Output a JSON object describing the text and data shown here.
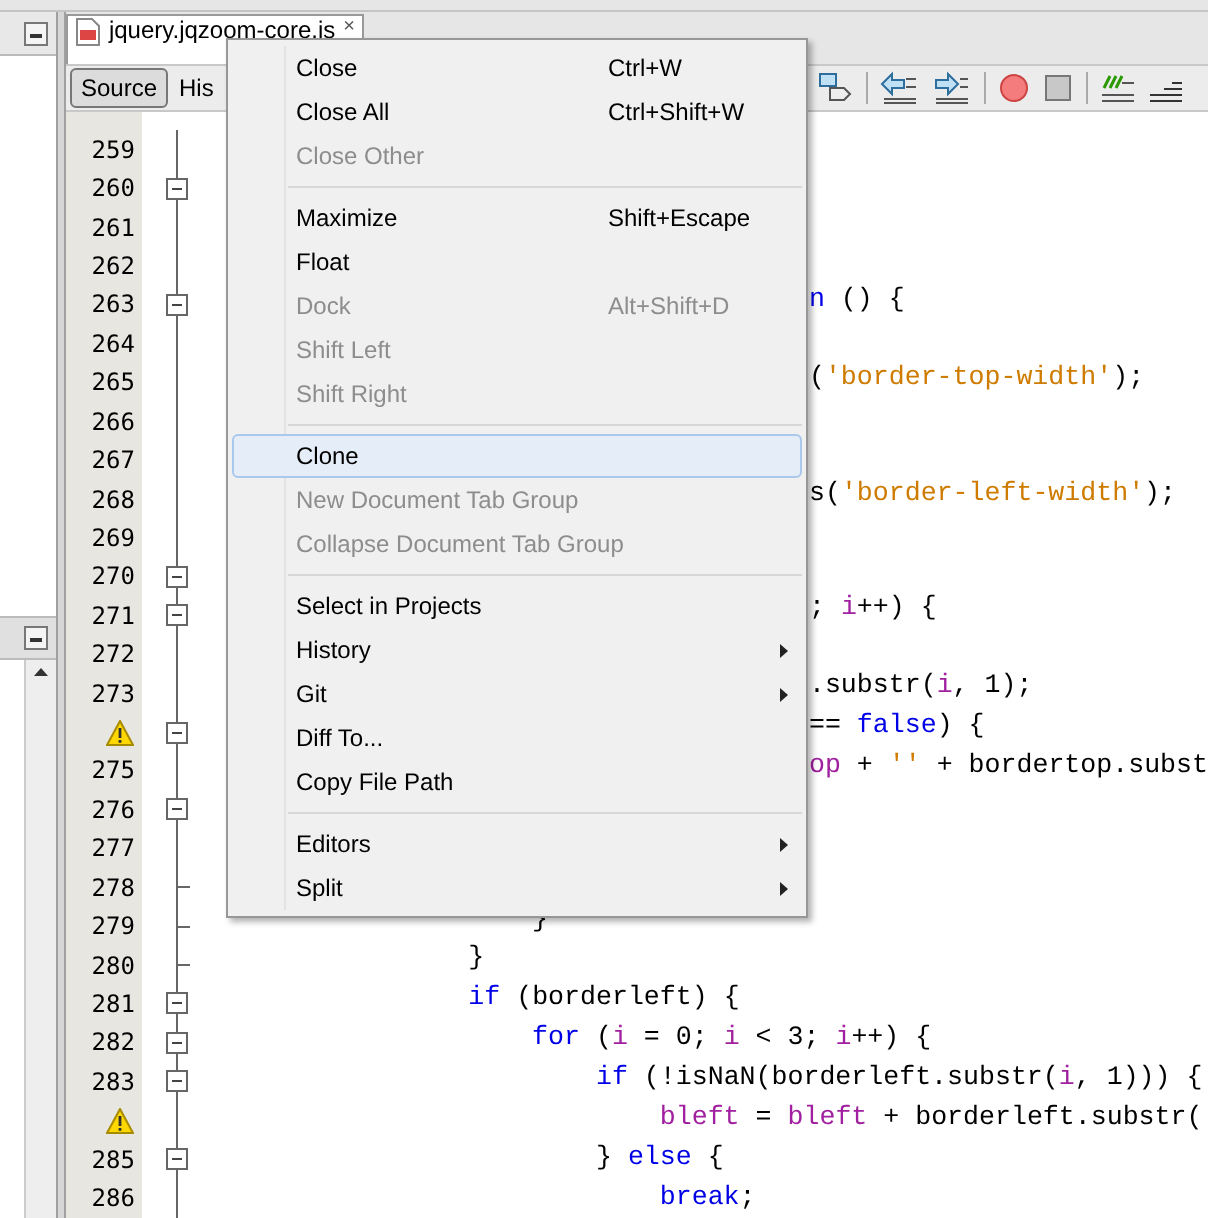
{
  "editor_tab": {
    "title": "jquery.jqzoom-core.js",
    "close": "×"
  },
  "view_buttons": [
    {
      "label": "Source",
      "selected": true
    },
    {
      "label": "His",
      "selected": false
    }
  ],
  "lines": [
    {
      "number": "259"
    },
    {
      "number": "260",
      "foldable": true
    },
    {
      "number": "261"
    },
    {
      "number": "262"
    },
    {
      "number": "263",
      "foldable": true,
      "kind": "clipped",
      "tokens": [
        {
          "text": "n",
          "kind": "keyword"
        },
        {
          "text": " () {",
          "kind": "plain"
        }
      ]
    },
    {
      "number": "264"
    },
    {
      "number": "265",
      "kind": "clipped",
      "tokens": [
        {
          "text": "(",
          "kind": "plain"
        },
        {
          "text": "'border-top-width'",
          "kind": "string"
        },
        {
          "text": ");",
          "kind": "plain"
        }
      ]
    },
    {
      "number": "266"
    },
    {
      "number": "267"
    },
    {
      "number": "268",
      "kind": "clipped",
      "tokens": [
        {
          "text": "s(",
          "kind": "plain"
        },
        {
          "text": "'border-left-width'",
          "kind": "string"
        },
        {
          "text": ");",
          "kind": "plain"
        }
      ]
    },
    {
      "number": "269"
    },
    {
      "number": "270",
      "foldable": true
    },
    {
      "number": "271",
      "foldable": true,
      "kind": "clipped",
      "tokens": [
        {
          "text": "; ",
          "kind": "plain"
        },
        {
          "text": "i",
          "kind": "var"
        },
        {
          "text": "++) {",
          "kind": "plain"
        }
      ]
    },
    {
      "number": "272"
    },
    {
      "number": "273",
      "kind": "clipped",
      "tokens": [
        {
          "text": ".substr(",
          "kind": "plain"
        },
        {
          "text": "i",
          "kind": "var"
        },
        {
          "text": ", 1);",
          "kind": "plain"
        }
      ]
    },
    {
      "warning": true,
      "foldable": true,
      "kind": "clipped",
      "tokens": [
        {
          "text": "== ",
          "kind": "plain"
        },
        {
          "text": "false",
          "kind": "keyword"
        },
        {
          "text": ") {",
          "kind": "plain"
        }
      ]
    },
    {
      "number": "275",
      "kind": "clipped",
      "tokens": [
        {
          "text": "op",
          "kind": "var"
        },
        {
          "text": " + ",
          "kind": "plain"
        },
        {
          "text": "''",
          "kind": "string"
        },
        {
          "text": " + bordertop.subst",
          "kind": "plain"
        }
      ]
    },
    {
      "number": "276",
      "foldable": true
    },
    {
      "number": "277"
    },
    {
      "number": "278",
      "fold_end": true
    },
    {
      "number": "279",
      "fold_end": true,
      "tokens": [
        {
          "text": "                    }",
          "kind": "plain"
        }
      ]
    },
    {
      "number": "280",
      "fold_end": true,
      "tokens": [
        {
          "text": "                }",
          "kind": "plain"
        }
      ]
    },
    {
      "number": "281",
      "foldable": true,
      "tokens": [
        {
          "text": "                if",
          "kind": "keyword"
        },
        {
          "text": " (borderleft) {",
          "kind": "plain"
        }
      ]
    },
    {
      "number": "282",
      "foldable": true,
      "tokens": [
        {
          "text": "                    for",
          "kind": "keyword"
        },
        {
          "text": " (",
          "kind": "plain"
        },
        {
          "text": "i",
          "kind": "var"
        },
        {
          "text": " = 0; ",
          "kind": "plain"
        },
        {
          "text": "i",
          "kind": "var"
        },
        {
          "text": " < 3; ",
          "kind": "plain"
        },
        {
          "text": "i",
          "kind": "var"
        },
        {
          "text": "++) {",
          "kind": "plain"
        }
      ]
    },
    {
      "number": "283",
      "foldable": true,
      "tokens": [
        {
          "text": "                        if",
          "kind": "keyword"
        },
        {
          "text": " (!isNaN(borderleft.substr(",
          "kind": "plain"
        },
        {
          "text": "i",
          "kind": "var"
        },
        {
          "text": ", 1))) {",
          "kind": "plain"
        }
      ]
    },
    {
      "warning": true,
      "tokens": [
        {
          "text": "                            bleft",
          "kind": "var"
        },
        {
          "text": " = ",
          "kind": "plain"
        },
        {
          "text": "bleft",
          "kind": "var"
        },
        {
          "text": " + borderleft.substr(",
          "kind": "plain"
        }
      ]
    },
    {
      "number": "285",
      "foldable": true,
      "tokens": [
        {
          "text": "                        } ",
          "kind": "plain"
        },
        {
          "text": "else",
          "kind": "keyword"
        },
        {
          "text": " {",
          "kind": "plain"
        }
      ]
    },
    {
      "number": "286",
      "tokens": [
        {
          "text": "                            break",
          "kind": "keyword"
        },
        {
          "text": ";",
          "kind": "plain"
        }
      ]
    }
  ],
  "context_menu": [
    {
      "kind": "item",
      "label": "Close",
      "shortcut": "Ctrl+W",
      "disabled": false,
      "selected": false
    },
    {
      "kind": "item",
      "label": "Close All",
      "shortcut": "Ctrl+Shift+W",
      "disabled": false,
      "selected": false
    },
    {
      "kind": "item",
      "label": "Close Other",
      "disabled": true,
      "selected": false
    },
    {
      "kind": "separator"
    },
    {
      "kind": "item",
      "label": "Maximize",
      "shortcut": "Shift+Escape",
      "disabled": false,
      "selected": false
    },
    {
      "kind": "item",
      "label": "Float",
      "disabled": false,
      "selected": false
    },
    {
      "kind": "item",
      "label": "Dock",
      "shortcut": "Alt+Shift+D",
      "disabled": true,
      "selected": false
    },
    {
      "kind": "item",
      "label": "Shift Left",
      "disabled": true,
      "selected": false
    },
    {
      "kind": "item",
      "label": "Shift Right",
      "disabled": true,
      "selected": false
    },
    {
      "kind": "separator"
    },
    {
      "kind": "item",
      "label": "Clone",
      "disabled": false,
      "selected": true
    },
    {
      "kind": "item",
      "label": "New Document Tab Group",
      "disabled": true,
      "selected": false
    },
    {
      "kind": "item",
      "label": "Collapse Document Tab Group",
      "disabled": true,
      "selected": false
    },
    {
      "kind": "separator"
    },
    {
      "kind": "item",
      "label": "Select in Projects",
      "disabled": false,
      "selected": false
    },
    {
      "kind": "item",
      "label": "History",
      "disabled": false,
      "selected": false,
      "submenu": true
    },
    {
      "kind": "item",
      "label": "Git",
      "disabled": false,
      "selected": false,
      "submenu": true
    },
    {
      "kind": "item",
      "label": "Diff To...",
      "disabled": false,
      "selected": false
    },
    {
      "kind": "item",
      "label": "Copy File Path",
      "disabled": false,
      "selected": false
    },
    {
      "kind": "separator"
    },
    {
      "kind": "item",
      "label": "Editors",
      "disabled": false,
      "selected": false,
      "submenu": true
    },
    {
      "kind": "item",
      "label": "Split",
      "disabled": false,
      "selected": false,
      "submenu": true
    }
  ]
}
